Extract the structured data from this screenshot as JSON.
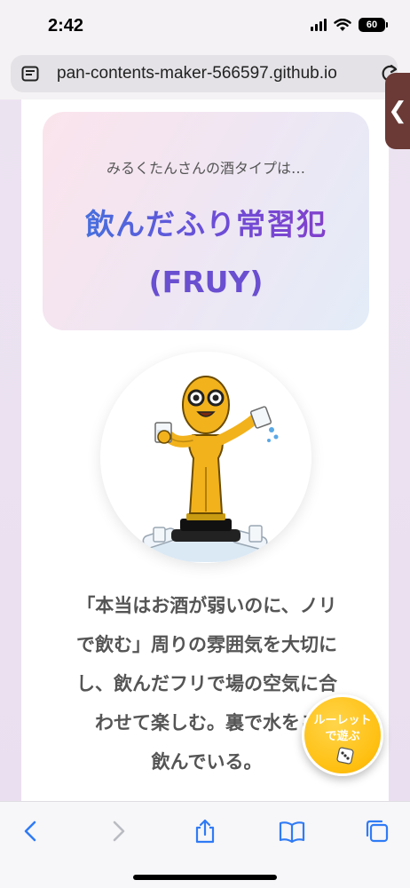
{
  "status": {
    "time": "2:42",
    "battery": "60"
  },
  "browser": {
    "url": "pan-contents-maker-566597.github.io"
  },
  "side_handle": {
    "glyph": "❮"
  },
  "result": {
    "intro": "みるくたんさんの酒タイプは…",
    "type_name": "飲んだふり常習犯",
    "type_code": "(FRUY)",
    "description": "「本当はお酒が弱いのに、ノリで飲む」周りの雰囲気を大切にし、飲んだフリで場の空気に合わせて楽しむ。裏で水をこっそり飲んでいる。",
    "description_lines": [
      "「本当はお酒が弱いのに、ノリ",
      "で飲む」周りの雰囲気を大切に",
      "し、飲んだフリで場の空気に合",
      "わせて楽しむ。裏で水をこ",
      "飲んでいる。"
    ]
  },
  "roulette_button": {
    "label": "ルーレット\nで遊ぶ"
  },
  "icons": {
    "reader": "reader-icon",
    "reload": "reload-icon",
    "back": "chevron-left-icon",
    "forward": "chevron-right-icon",
    "share": "share-icon",
    "bookmarks": "book-icon",
    "tabs": "tabs-icon",
    "dice": "dice-icon"
  },
  "colors": {
    "accent_blue": "#2f7bf6",
    "title_gradient_start": "#3a7be0",
    "title_gradient_end": "#8a3bc8",
    "roulette": "#ffbf10"
  }
}
